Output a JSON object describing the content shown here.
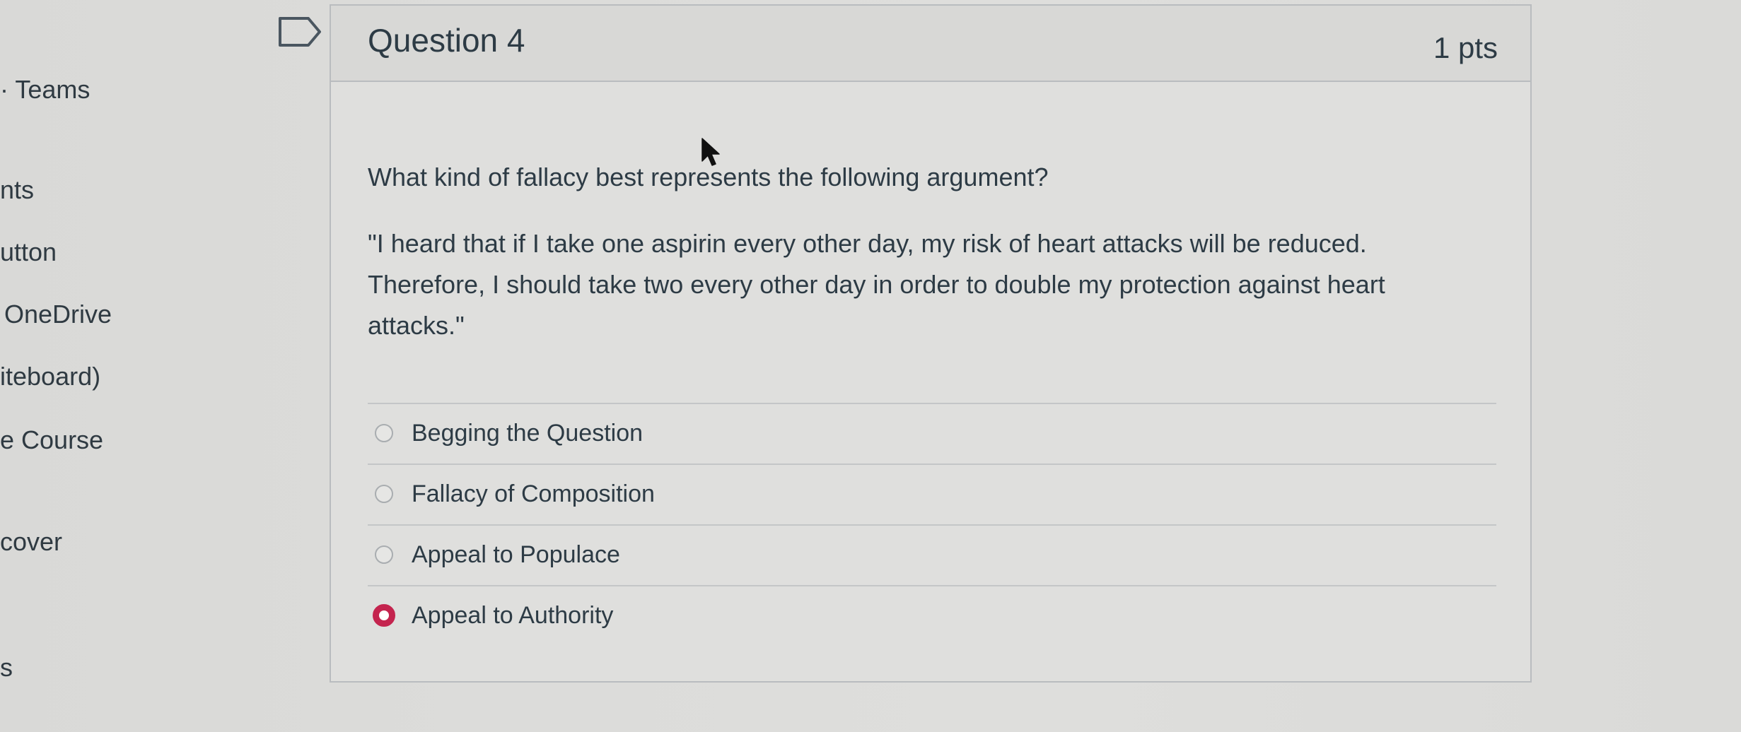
{
  "sidebar": {
    "items": [
      {
        "label": "Teams"
      },
      {
        "label": "nts"
      },
      {
        "label": "utton"
      },
      {
        "label": "OneDrive"
      },
      {
        "label": "iteboard)"
      },
      {
        "label": "e Course"
      },
      {
        "label": "cover"
      },
      {
        "label": "s"
      }
    ]
  },
  "question": {
    "title": "Question 4",
    "points": "1 pts",
    "prompt": "What kind of fallacy best represents the following argument?",
    "quote_lines": [
      "\"I heard that if I take one aspirin every other day, my risk of heart attacks will be reduced.",
      "Therefore, I should take two every other day in order to double my protection against heart",
      "attacks.\""
    ],
    "answers": [
      {
        "label": "Begging the Question",
        "selected": false
      },
      {
        "label": "Fallacy of Composition",
        "selected": false
      },
      {
        "label": "Appeal to Populace",
        "selected": false
      },
      {
        "label": "Appeal to Authority",
        "selected": true
      }
    ]
  },
  "icons": {
    "flag": "flag-icon",
    "cursor": "mouse-pointer-icon"
  },
  "colors": {
    "selected_radio": "#c4244e",
    "text": "#2d3b45",
    "border": "#b9bcbf"
  }
}
